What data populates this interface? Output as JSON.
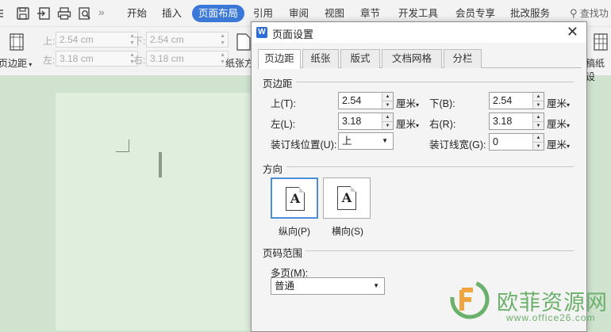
{
  "toolbar": {
    "tabs": [
      "开始",
      "插入",
      "页面布局",
      "引用",
      "审阅",
      "视图",
      "章节",
      "开发工具",
      "会员专享",
      "批改服务"
    ],
    "active_tab": "页面布局",
    "search_placeholder": "查找功",
    "overflow_icon": "chevrons-right-icon",
    "accent_color": "#3b78d8"
  },
  "ribbon": {
    "margins_label": "页边距",
    "top_label": "上:",
    "top_value": "2.54 cm",
    "bottom_label": "下:",
    "bottom_value": "2.54 cm",
    "left_label": "左:",
    "left_value": "3.18 cm",
    "right_label": "右:",
    "right_value": "3.18 cm",
    "paper_label": "纸张方",
    "right_cut_label": "稿纸设"
  },
  "dialog": {
    "title": "页面设置",
    "logo": "W",
    "tabs": [
      "页边距",
      "纸张",
      "版式",
      "文档网格",
      "分栏"
    ],
    "margins_group": "页边距",
    "fields": {
      "top": {
        "label": "上(T):",
        "value": "2.54",
        "unit": "厘米"
      },
      "bottom": {
        "label": "下(B):",
        "value": "2.54",
        "unit": "厘米"
      },
      "left": {
        "label": "左(L):",
        "value": "3.18",
        "unit": "厘米"
      },
      "right": {
        "label": "右(R):",
        "value": "3.18",
        "unit": "厘米"
      },
      "gutter_pos": {
        "label": "装订线位置(U):",
        "value": "上"
      },
      "gutter_width": {
        "label": "装订线宽(G):",
        "value": "0",
        "unit": "厘米"
      }
    },
    "orientation_group": "方向",
    "portrait_label": "纵向(P)",
    "landscape_label": "横向(S)",
    "orientation_selected": "portrait",
    "page_range_group": "页码范围",
    "multi_label": "多页(M):",
    "multi_value": "普通",
    "selected_color": "#4a8fd8"
  },
  "watermark": {
    "text": "欧菲资源网",
    "url": "www.office26.com"
  }
}
